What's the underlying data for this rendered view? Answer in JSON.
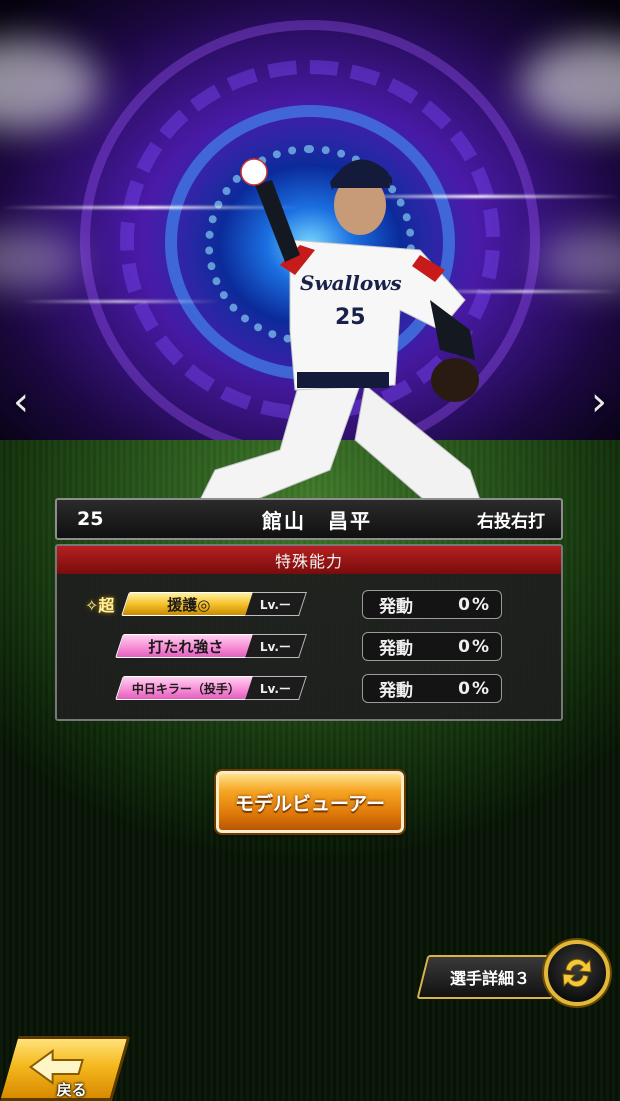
{
  "player": {
    "number": "25",
    "name": "館山　昌平",
    "handedness": "右投右打",
    "uniform_number": "25",
    "team_script": "Swallows"
  },
  "abilities": {
    "header": "特殊能力",
    "items": [
      {
        "prefix": "超",
        "name": "援護◎",
        "level": "Lv.ー",
        "activation_label": "発動",
        "activation_value": "0%",
        "color": "gold"
      },
      {
        "prefix": "",
        "name": "打たれ強さ",
        "level": "Lv.ー",
        "activation_label": "発動",
        "activation_value": "0%",
        "color": "pink"
      },
      {
        "prefix": "",
        "name": "中日キラー（投手）",
        "level": "Lv.ー",
        "activation_label": "発動",
        "activation_value": "0%",
        "color": "pink"
      }
    ]
  },
  "buttons": {
    "model_viewer": "モデルビューアー",
    "player_detail": "選手詳細３",
    "back": "戻る"
  },
  "icons": {
    "prev": "chevron-left-icon",
    "next": "chevron-right-icon",
    "swap": "swap-arrows-icon",
    "back": "back-arrow-icon"
  },
  "colors": {
    "ability_header": "#9a1414",
    "gold_tag": "#f5c22c",
    "pink_tag": "#f78fd6",
    "button_orange": "#e07a0a"
  }
}
